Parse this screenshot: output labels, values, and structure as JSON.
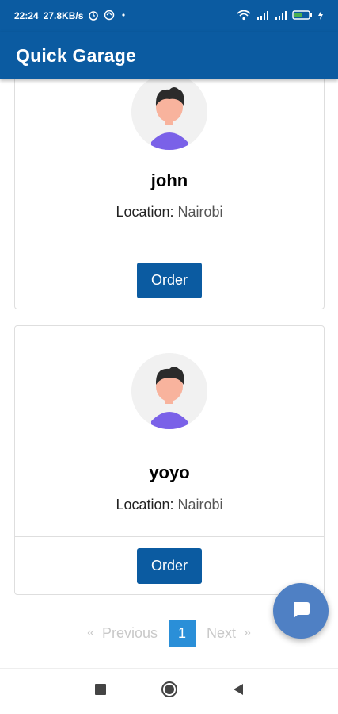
{
  "status_bar": {
    "time": "22:24",
    "speed": "27.8KB/s",
    "battery": "53",
    "icons": [
      "alarm-icon",
      "sync-icon",
      "dot-icon",
      "wifi-icon",
      "signal-4g-icon",
      "signal-icon",
      "battery-icon",
      "charging-icon"
    ]
  },
  "app_bar": {
    "title": "Quick Garage"
  },
  "cards": [
    {
      "name": "john",
      "location_label": "Location:",
      "location_value": "Nairobi",
      "button": "Order"
    },
    {
      "name": "yoyo",
      "location_label": "Location:",
      "location_value": "Nairobi",
      "button": "Order"
    }
  ],
  "pagination": {
    "prev": "Previous",
    "page": "1",
    "next": "Next",
    "prev_arrow": "«",
    "next_arrow": "»"
  },
  "colors": {
    "primary": "#0b5ba1",
    "page_active": "#2a8fd8",
    "fab": "#4f80c4"
  }
}
